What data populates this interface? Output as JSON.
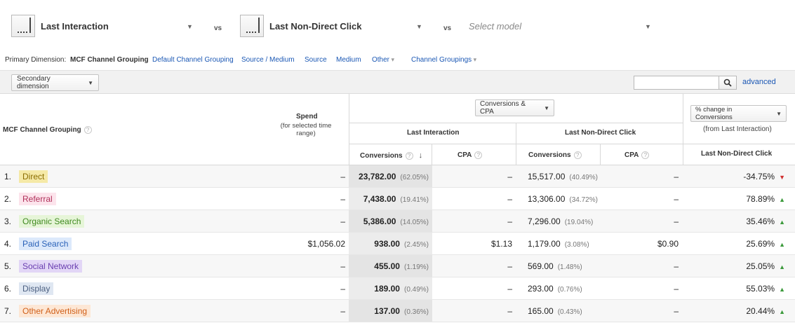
{
  "models": [
    {
      "name": "Last Interaction"
    },
    {
      "name": "Last Non-Direct Click"
    },
    {
      "name": "Select model"
    }
  ],
  "vs_label": "vs",
  "dimensions": {
    "label": "Primary Dimension:",
    "current": "MCF Channel Grouping",
    "links": [
      "Default Channel Grouping",
      "Source / Medium",
      "Source",
      "Medium",
      "Other",
      "Channel Groupings"
    ]
  },
  "toolbar": {
    "secondary_dimension": "Secondary dimension",
    "search_value": "",
    "advanced": "advanced"
  },
  "table": {
    "dim_header": "MCF Channel Grouping",
    "spend_header": "Spend",
    "spend_sub": "(for selected time range)",
    "metric_select": "Conversions & CPA",
    "model1": "Last Interaction",
    "model2": "Last Non-Direct Click",
    "conversions": "Conversions",
    "cpa": "CPA",
    "change_select": "% change in Conversions",
    "change_sub": "(from Last Interaction)",
    "change_model": "Last Non-Direct Click",
    "rows": [
      {
        "idx": "1.",
        "channel": "Direct",
        "bg": "#f5e9a7",
        "fg": "#8a6d00",
        "spend": "–",
        "conv1": "23,782.00",
        "pct1": "(62.05%)",
        "cpa1": "–",
        "conv2": "15,517.00",
        "pct2": "(40.49%)",
        "cpa2": "–",
        "change": "-34.75%",
        "dir": "down"
      },
      {
        "idx": "2.",
        "channel": "Referral",
        "bg": "#fce4ec",
        "fg": "#b0305a",
        "spend": "–",
        "conv1": "7,438.00",
        "pct1": "(19.41%)",
        "cpa1": "–",
        "conv2": "13,306.00",
        "pct2": "(34.72%)",
        "cpa2": "–",
        "change": "78.89%",
        "dir": "up"
      },
      {
        "idx": "3.",
        "channel": "Organic Search",
        "bg": "#e6f5d8",
        "fg": "#3f8a1f",
        "spend": "–",
        "conv1": "5,386.00",
        "pct1": "(14.05%)",
        "cpa1": "–",
        "conv2": "7,296.00",
        "pct2": "(19.04%)",
        "cpa2": "–",
        "change": "35.46%",
        "dir": "up"
      },
      {
        "idx": "4.",
        "channel": "Paid Search",
        "bg": "#dce9fb",
        "fg": "#2a62b8",
        "spend": "$1,056.02",
        "conv1": "938.00",
        "pct1": "(2.45%)",
        "cpa1": "$1.13",
        "conv2": "1,179.00",
        "pct2": "(3.08%)",
        "cpa2": "$0.90",
        "change": "25.69%",
        "dir": "up"
      },
      {
        "idx": "5.",
        "channel": "Social Network",
        "bg": "#e2d6f6",
        "fg": "#6a3fb0",
        "spend": "–",
        "conv1": "455.00",
        "pct1": "(1.19%)",
        "cpa1": "–",
        "conv2": "569.00",
        "pct2": "(1.48%)",
        "cpa2": "–",
        "change": "25.05%",
        "dir": "up"
      },
      {
        "idx": "6.",
        "channel": "Display",
        "bg": "#dfe7f2",
        "fg": "#4b5f80",
        "spend": "–",
        "conv1": "189.00",
        "pct1": "(0.49%)",
        "cpa1": "–",
        "conv2": "293.00",
        "pct2": "(0.76%)",
        "cpa2": "–",
        "change": "55.03%",
        "dir": "up"
      },
      {
        "idx": "7.",
        "channel": "Other Advertising",
        "bg": "#fde7d5",
        "fg": "#d0601a",
        "spend": "–",
        "conv1": "137.00",
        "pct1": "(0.36%)",
        "cpa1": "–",
        "conv2": "165.00",
        "pct2": "(0.43%)",
        "cpa2": "–",
        "change": "20.44%",
        "dir": "up"
      }
    ]
  }
}
